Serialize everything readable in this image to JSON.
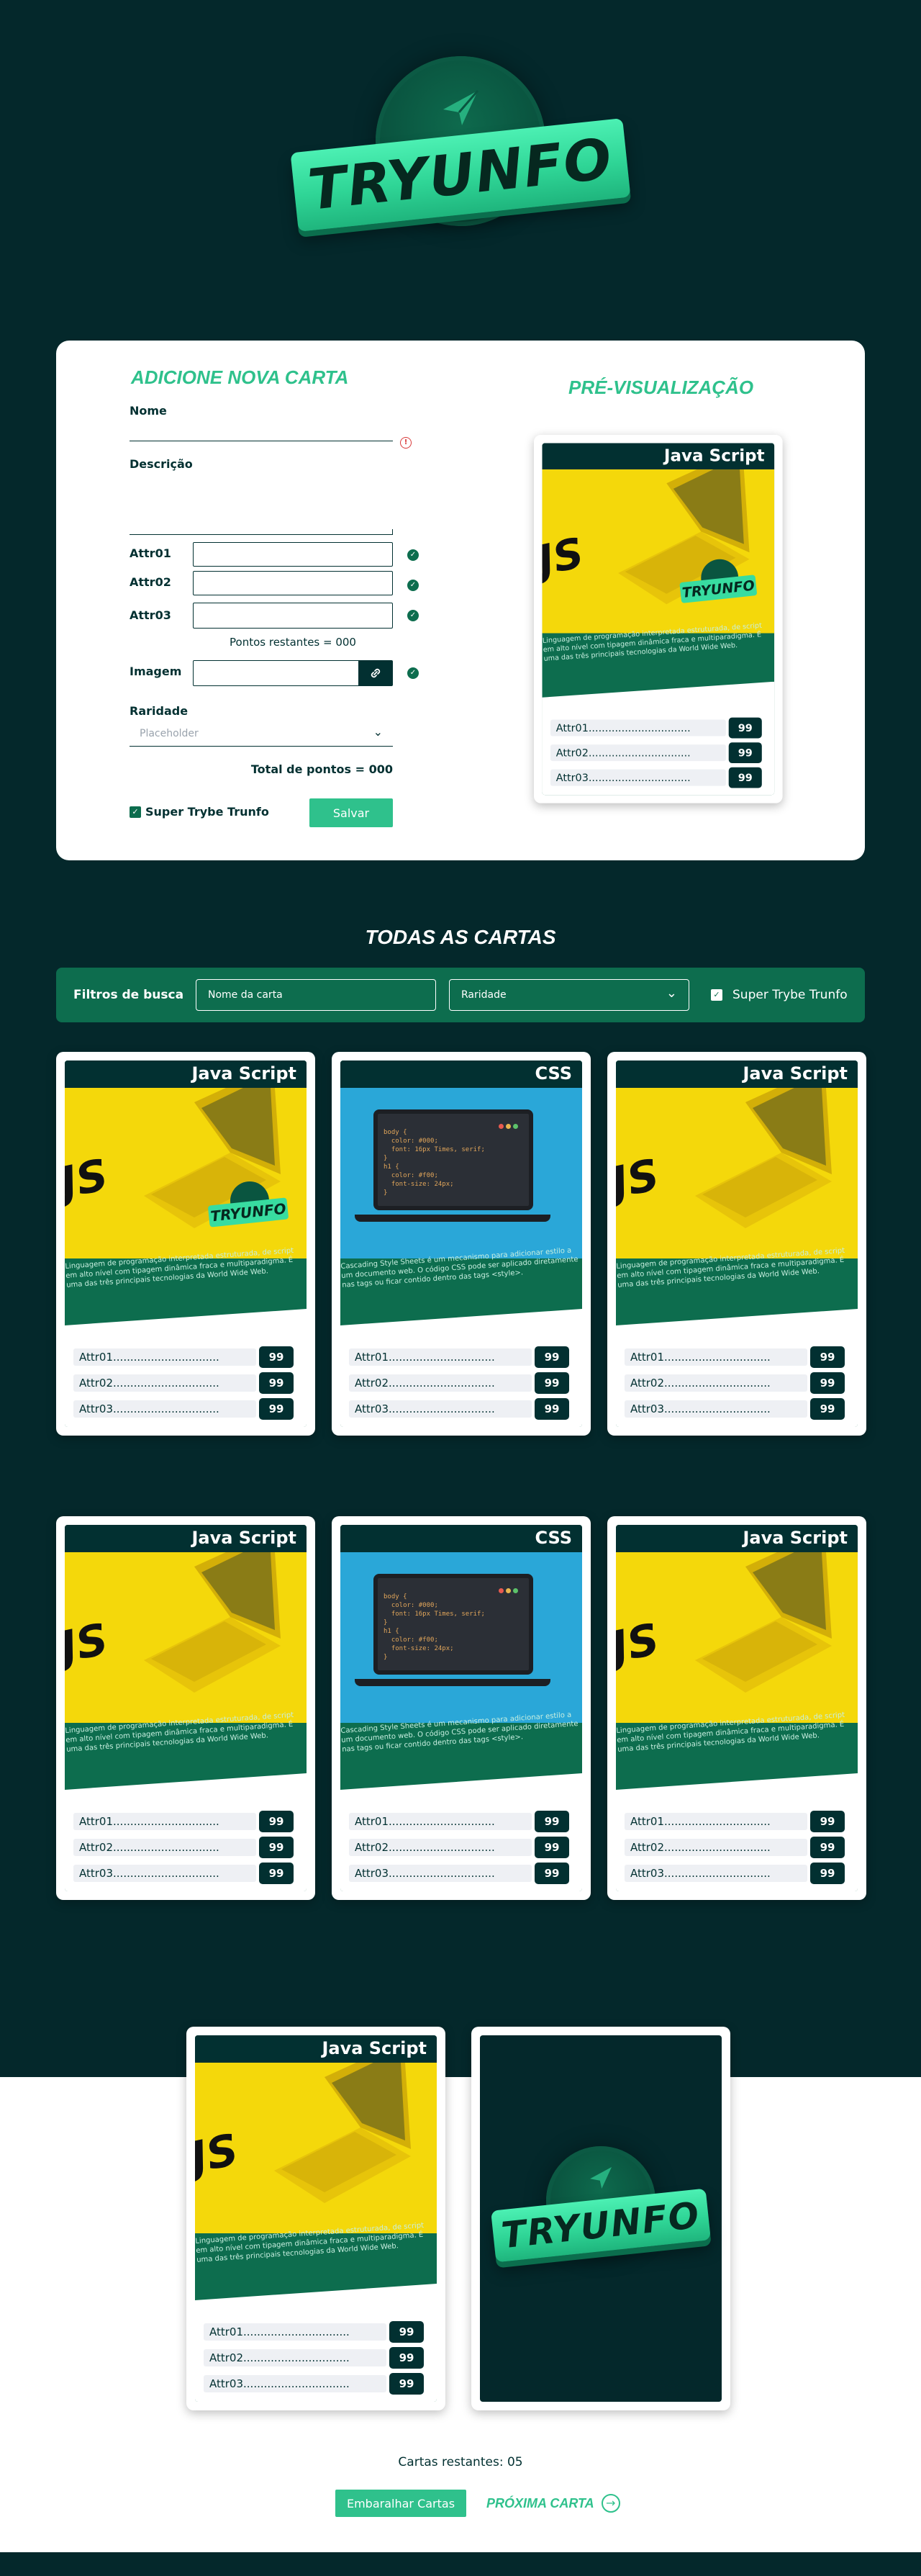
{
  "header": {
    "logo_text": "TRYUNFO"
  },
  "form": {
    "title": "ADICIONE NOVA CARTA",
    "name_label": "Nome",
    "description_label": "Descrição",
    "attr1_label": "Attr01",
    "attr2_label": "Attr02",
    "attr3_label": "Attr03",
    "remaining_points": "Pontos restantes = 000",
    "image_label": "Imagem",
    "rarity_label": "Raridade",
    "rarity_placeholder": "Placeholder",
    "total_points": "Total de pontos = 000",
    "super_trunfo_label": "Super Trybe Trunfo",
    "save_button": "Salvar"
  },
  "preview": {
    "title": "PRÉ-VISUALIZAÇÃO"
  },
  "all_cards": {
    "title": "TODAS AS CARTAS",
    "filter_label": "Filtros de busca",
    "name_filter_placeholder": "Nome da carta",
    "rarity_filter_value": "Raridade",
    "super_trunfo_filter_label": "Super Trybe Trunfo"
  },
  "cards": [
    {
      "name": "Java Script",
      "theme": "js",
      "trunfo": true,
      "description": "Linguagem de programação interpretada estruturada, de script em alto nível com tipagem dinâmica fraca e multiparadigma. É uma das três principais tecnologias da World Wide Web.",
      "attr1_label": "Attr01...............................",
      "attr2_label": "Attr02...............................",
      "attr3_label": "Attr03...............................",
      "attr1": "99",
      "attr2": "99",
      "attr3": "99"
    },
    {
      "name": "CSS",
      "theme": "css",
      "trunfo": false,
      "description": "Cascading Style Sheets é um mecanismo para adicionar estilo a um documento web. O código CSS pode ser aplicado diretamente nas tags ou ficar contido dentro das tags <style>.",
      "attr1_label": "Attr01...............................",
      "attr2_label": "Attr02...............................",
      "attr3_label": "Attr03...............................",
      "attr1": "99",
      "attr2": "99",
      "attr3": "99"
    },
    {
      "name": "Java Script",
      "theme": "js",
      "trunfo": false,
      "description": "Linguagem de programação interpretada estruturada, de script em alto nível com tipagem dinâmica fraca e multiparadigma. É uma das três principais tecnologias da World Wide Web.",
      "attr1_label": "Attr01...............................",
      "attr2_label": "Attr02...............................",
      "attr3_label": "Attr03...............................",
      "attr1": "99",
      "attr2": "99",
      "attr3": "99"
    }
  ],
  "css_code": [
    "body {",
    "  color: #000;",
    "  font: 16px Times, serif;",
    "}",
    "h1 {",
    "  color: #f00;",
    "  font-size: 24px;",
    "}"
  ],
  "game": {
    "remaining_cards": "Cartas restantes: 05",
    "shuffle_button": "Embaralhar Cartas",
    "next_card_button": "PRÓXIMA CARTA"
  }
}
